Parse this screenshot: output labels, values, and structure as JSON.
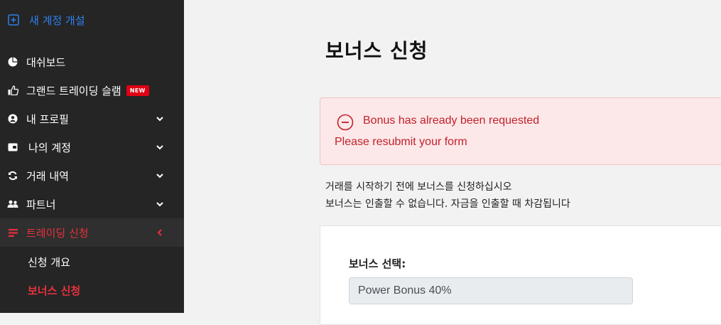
{
  "sidebar": {
    "new_account": "새 계정 개설",
    "items": [
      {
        "label": "대쉬보드"
      },
      {
        "label": "그랜드 트레이딩 슬램",
        "badge": "NEW"
      },
      {
        "label": "내 프로필"
      },
      {
        "label": "나의 계정"
      },
      {
        "label": "거래 내역"
      },
      {
        "label": "파트너"
      },
      {
        "label": "트레이딩 신청"
      }
    ],
    "subitems": [
      {
        "label": "신청 개요"
      },
      {
        "label": "보너스 신청"
      }
    ]
  },
  "main": {
    "title": "보너스 신청",
    "alert": {
      "message": "Bonus has already been requested",
      "detail": "Please resubmit your form"
    },
    "info_line1": "거래를 시작하기 전에 보너스를 신청하십시오",
    "info_line2": "보너스는 인출할 수 없습니다. 자금을 인출할 때 차감됩니다",
    "bonus_select": {
      "label": "보너스 선택:",
      "value": "Power Bonus 40%"
    }
  },
  "colors": {
    "sidebar_bg": "#252525",
    "accent_blue": "#2f80ed",
    "accent_red": "#e8313d",
    "alert_bg": "#fce8e8",
    "alert_text": "#c4202b"
  },
  "icons": [
    "plus-square-icon",
    "pie-chart-icon",
    "thumbs-up-icon",
    "user-circle-icon",
    "wallet-icon",
    "refresh-icon",
    "users-icon",
    "list-icon",
    "chevron-down-icon",
    "chevron-left-icon",
    "minus-circle-icon"
  ]
}
